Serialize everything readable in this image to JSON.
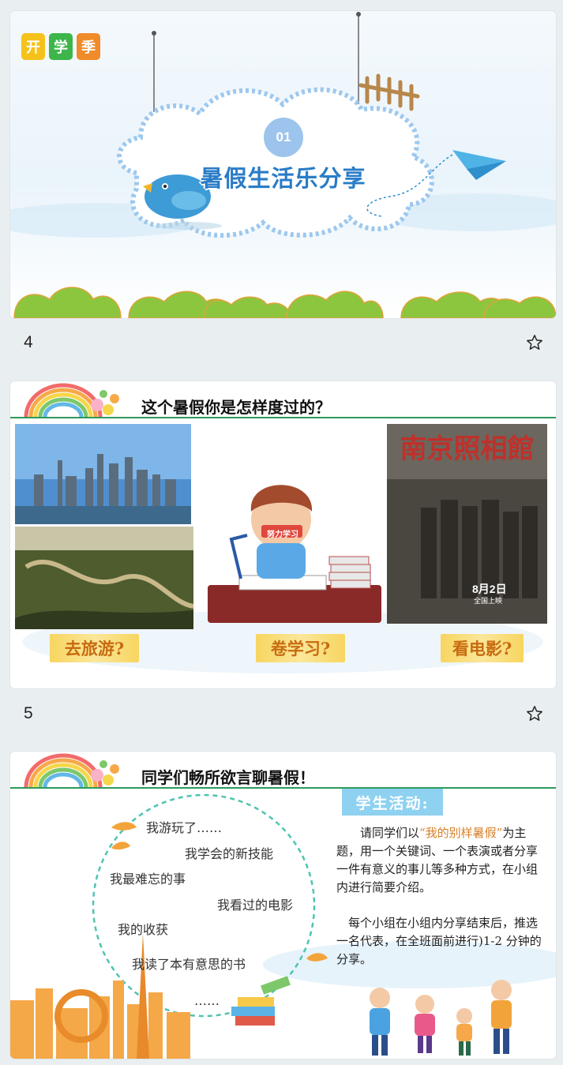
{
  "slides": [
    {
      "number": "4",
      "logo": [
        "开",
        "学",
        "季"
      ],
      "badge": "01",
      "title": "暑假生活乐分享"
    },
    {
      "number": "5",
      "title": "这个暑假你是怎样度过的？",
      "study_headband": "努力学习",
      "movie_poster": {
        "title": "南京照相館",
        "date": "8月2日",
        "release": "全国上映"
      },
      "captions": [
        "去旅游?",
        "卷学习?",
        "看电影?"
      ]
    },
    {
      "title": "同学们畅所欲言聊暑假！",
      "bubble_items": [
        "我游玩了……",
        "我学会的新技能",
        "我最难忘的事",
        "我看过的电影",
        "我的收获",
        "我读了本有意思的书",
        "……"
      ],
      "activity_label": "学生活动:",
      "paragraph1_pre": "请同学们以",
      "paragraph1_highlight": "“我的别样暑假”",
      "paragraph1_post": "为主题，用一个关键词、一个表演或者分享一件有意义的事儿等多种方式，在小组内进行简要介绍。",
      "paragraph2": "每个小组在小组内分享结束后，推选一名代表，在全班面前进行)1-2 分钟的分享。"
    }
  ],
  "colors": {
    "background": "#e9eef1",
    "accent_green": "#2e9a5b",
    "title_blue": "#2a7cc7",
    "highlight_orange": "#d9812a"
  },
  "icons": [
    "star-outline-icon"
  ]
}
